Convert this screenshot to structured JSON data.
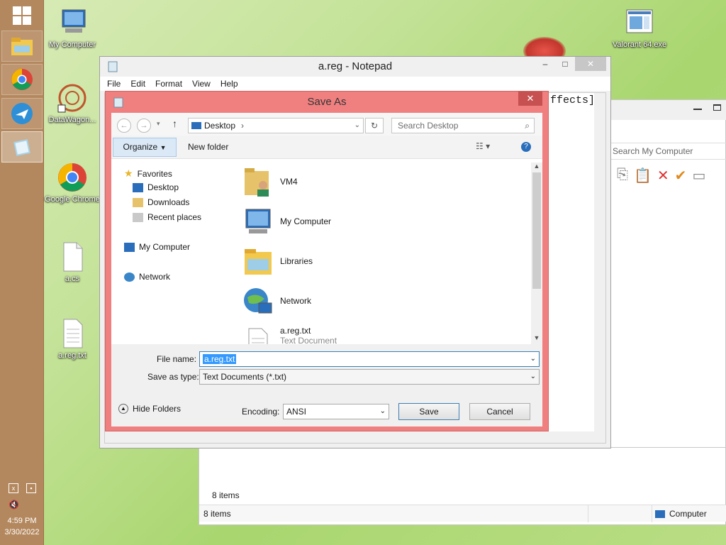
{
  "taskbar": {
    "clock_time": "4:59 PM",
    "clock_date": "3/30/2022"
  },
  "desktop_icons": [
    {
      "label": "My Computer"
    },
    {
      "label": "DataWagon..."
    },
    {
      "label": "Google Chrome"
    },
    {
      "label": "a.cs"
    },
    {
      "label": "a.reg.txt"
    },
    {
      "label": "Valorant 64.exe"
    }
  ],
  "notepad": {
    "title": "a.reg - Notepad",
    "menu": [
      "File",
      "Edit",
      "Format",
      "View",
      "Help"
    ],
    "visible_text": "ffects]"
  },
  "explorer": {
    "search_placeholder": "Search My Computer",
    "items_count": "8 items",
    "status_items": "8 items",
    "status_location": "Computer"
  },
  "save_dialog": {
    "title": "Save As",
    "address": "Desktop",
    "search_placeholder": "Search Desktop",
    "organize_label": "Organize",
    "new_folder_label": "New folder",
    "nav": {
      "favorites": "Favorites",
      "desktop": "Desktop",
      "downloads": "Downloads",
      "recent": "Recent places",
      "my_computer": "My Computer",
      "network": "Network"
    },
    "files": [
      {
        "name": "VM4"
      },
      {
        "name": "My Computer"
      },
      {
        "name": "Libraries"
      },
      {
        "name": "Network"
      },
      {
        "name": "a.reg.txt",
        "subtitle": "Text Document"
      }
    ],
    "file_name_label": "File name:",
    "file_name_value": "a.reg.txt",
    "save_type_label": "Save as type:",
    "save_type_value": "Text Documents (*.txt)",
    "hide_folders_label": "Hide Folders",
    "encoding_label": "Encoding:",
    "encoding_value": "ANSI",
    "save_label": "Save",
    "cancel_label": "Cancel"
  }
}
